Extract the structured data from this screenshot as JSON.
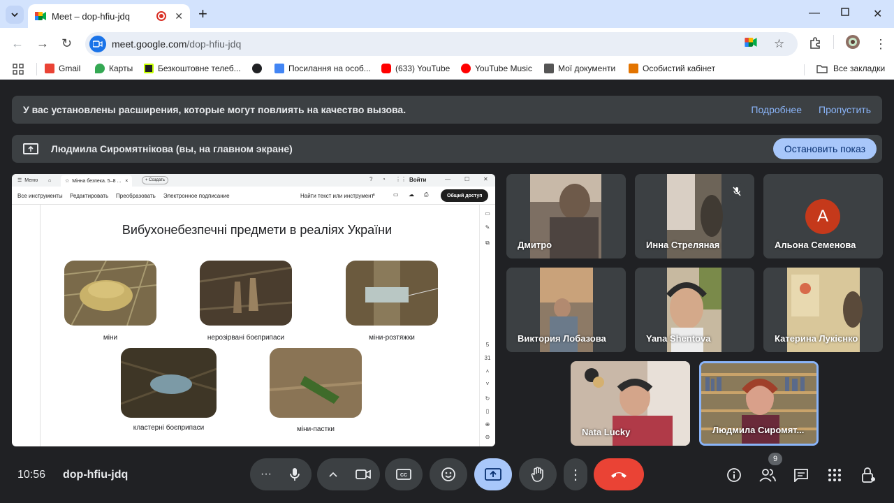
{
  "browser": {
    "tab_title": "Meet – dop-hfiu-jdq",
    "url_host": "meet.google.com",
    "url_path": "/dop-hfiu-jdq",
    "bookmarks": [
      {
        "label": "Gmail",
        "icon": "gmail-icon",
        "color": "#ea4335"
      },
      {
        "label": "Карты",
        "icon": "maps-icon",
        "color": "#34a853"
      },
      {
        "label": "Безкоштовне телеб...",
        "icon": "tv-icon",
        "color": "#202124"
      },
      {
        "label": "",
        "icon": "globe-icon",
        "color": "#202124"
      },
      {
        "label": "Посилання на особ...",
        "icon": "docs-icon",
        "color": "#4285f4"
      },
      {
        "label": "(633) YouTube",
        "icon": "youtube-icon",
        "color": "#ff0000"
      },
      {
        "label": "YouTube Music",
        "icon": "youtube-music-icon",
        "color": "#ff0000"
      },
      {
        "label": "Мої документи",
        "icon": "eac-icon",
        "color": "#555555"
      },
      {
        "label": "Особистий кабінет",
        "icon": "cabinet-icon",
        "color": "#e37400"
      }
    ],
    "all_bookmarks": "Все закладки"
  },
  "meet": {
    "ext_warning": "У вас установлены расширения, которые могут повлиять на качество вызова.",
    "ext_more": "Подробнее",
    "ext_skip": "Пропустить",
    "presenting_text": "Людмила Сиромятнікова (вы, на главном экране)",
    "stop_presenting": "Остановить показ",
    "time": "10:56",
    "meeting_code": "dop-hfiu-jdq",
    "participant_count": "9",
    "accent": "#a8c7fa",
    "end_call_color": "#ea4335"
  },
  "presentation": {
    "menu": "Меню",
    "tab_title": "Мінна безпека. 5–8 ...",
    "create": "+ Создать",
    "login": "Войти",
    "tools": [
      "Все инструменты",
      "Редактировать",
      "Преобразовать",
      "Электронное подписание"
    ],
    "search": "Найти текст или инструмент",
    "share": "Общий доступ",
    "page_num": "5",
    "page_total": "31",
    "slide_title": "Вибухонебезпечні предмети в реаліях України",
    "captions": [
      "міни",
      "нерозірвані боєприпаси",
      "міни-розтяжки",
      "кластерні боєприпаси",
      "міни-пастки"
    ]
  },
  "participants": [
    {
      "name": "Дмитро",
      "muted": false
    },
    {
      "name": "Инна Стреляная",
      "muted": true
    },
    {
      "name": "Альона Семенова",
      "avatar_letter": "A"
    },
    {
      "name": "Виктория Лобазова"
    },
    {
      "name": "Yana Shentova"
    },
    {
      "name": "Катерина Лукієнко"
    },
    {
      "name": "Nata Lucky"
    },
    {
      "name": "Людмила Сиромят..."
    }
  ]
}
